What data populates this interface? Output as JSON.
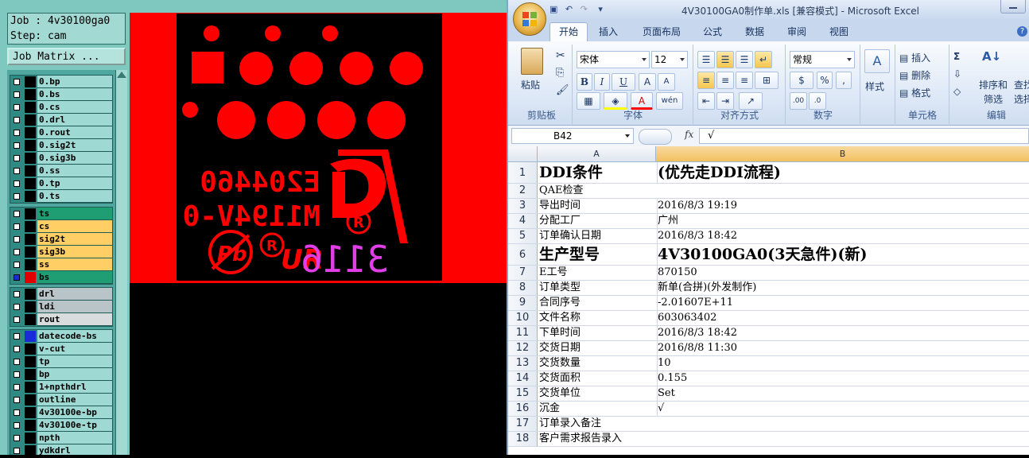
{
  "cam": {
    "job_label": "Job : 4v30100ga0",
    "step_label": "Step: cam",
    "matrix_button": "Job Matrix ...",
    "layer_groups": [
      {
        "layers": [
          {
            "name": "0.bp",
            "color": "#9fd9d3"
          },
          {
            "name": "0.bs",
            "color": "#9fd9d3"
          },
          {
            "name": "0.cs",
            "color": "#9fd9d3"
          },
          {
            "name": "0.drl",
            "color": "#9fd9d3"
          },
          {
            "name": "0.rout",
            "color": "#9fd9d3"
          },
          {
            "name": "0.sig2t",
            "color": "#9fd9d3"
          },
          {
            "name": "0.sig3b",
            "color": "#9fd9d3"
          },
          {
            "name": "0.ss",
            "color": "#9fd9d3"
          },
          {
            "name": "0.tp",
            "color": "#9fd9d3"
          },
          {
            "name": "0.ts",
            "color": "#9fd9d3"
          }
        ]
      },
      {
        "layers": [
          {
            "name": "ts",
            "color": "#1f9e74"
          },
          {
            "name": "cs",
            "color": "#ffcf66"
          },
          {
            "name": "sig2t",
            "color": "#ffcf66"
          },
          {
            "name": "sig3b",
            "color": "#ffcf66"
          },
          {
            "name": "ss",
            "color": "#ffcf66"
          },
          {
            "name": "bs",
            "color": "#1f9e74",
            "swatch": "#e00000",
            "selected": true
          }
        ]
      },
      {
        "layers": [
          {
            "name": "drl",
            "color": "#b8c4c8"
          },
          {
            "name": "ldi",
            "color": "#b8c4c8"
          },
          {
            "name": "rout",
            "color": "#d8dcdc"
          }
        ]
      },
      {
        "layers": [
          {
            "name": "datecode-bs",
            "color": "#9fd9d3",
            "swatch": "#1a2cd8"
          },
          {
            "name": "v-cut",
            "color": "#9fd9d3"
          },
          {
            "name": "tp",
            "color": "#9fd9d3"
          },
          {
            "name": "bp",
            "color": "#9fd9d3"
          },
          {
            "name": "1+npthdrl",
            "color": "#9fd9d3"
          },
          {
            "name": "outline",
            "color": "#9fd9d3"
          },
          {
            "name": "4v30100e-bp",
            "color": "#9fd9d3"
          },
          {
            "name": "4v30100e-tp",
            "color": "#9fd9d3"
          },
          {
            "name": "npth",
            "color": "#9fd9d3"
          },
          {
            "name": "ydkdrl",
            "color": "#9fd9d3"
          }
        ]
      }
    ],
    "board_text": {
      "line1": "E204460",
      "line2": "M1194V-0",
      "datecode": "3116",
      "ul_mark": "UR",
      "pb_mark": "Pb",
      "r_mark": "R"
    },
    "colors": {
      "copper": "#ff0000",
      "board": "#000000",
      "datecode": "#e23ee8"
    }
  },
  "excel": {
    "title": "4V30100GA0制作单.xls  [兼容模式] - Microsoft Excel",
    "tabs": [
      "开始",
      "插入",
      "页面布局",
      "公式",
      "数据",
      "审阅",
      "视图"
    ],
    "active_tab": "开始",
    "ribbon": {
      "clipboard": {
        "paste": "粘贴",
        "group": "剪贴板"
      },
      "font": {
        "name": "宋体",
        "size": "12",
        "group": "字体"
      },
      "alignment": {
        "group": "对齐方式"
      },
      "number": {
        "format": "常规",
        "percent": "%",
        "comma": ",",
        "group": "数字"
      },
      "styles": {
        "label": "样式"
      },
      "cells": {
        "insert": "插入",
        "delete": "删除",
        "format": "格式",
        "group": "单元格"
      },
      "editing": {
        "sort": "排序和",
        "sort2": "筛选",
        "find": "查找",
        "find2": "选择",
        "sum": "Σ",
        "group": "编辑"
      }
    },
    "formula": {
      "name_box": "B42",
      "fx": "fx",
      "value": "√"
    },
    "columns": [
      "A",
      "B"
    ],
    "rows": [
      {
        "n": "1",
        "a": "DDI条件",
        "b": "(优先走DDI流程)",
        "style": "big"
      },
      {
        "n": "2",
        "a": "QAE检查",
        "b": "",
        "style": "span"
      },
      {
        "n": "3",
        "a": "导出时间",
        "b": "2016/8/3 19:19"
      },
      {
        "n": "4",
        "a": "分配工厂",
        "b": "广州"
      },
      {
        "n": "5",
        "a": "订单确认日期",
        "b": "2016/8/3 18:42"
      },
      {
        "n": "6",
        "a": "生产型号",
        "b": "4V30100GA0(3天急件)(新)",
        "style": "big"
      },
      {
        "n": "7",
        "a": "E工号",
        "b": "870150"
      },
      {
        "n": "8",
        "a": "订单类型",
        "b": "新单(合拼)(外发制作)"
      },
      {
        "n": "9",
        "a": "合同序号",
        "b": "-2.01607E+11"
      },
      {
        "n": "10",
        "a": "文件名称",
        "b": "603063402"
      },
      {
        "n": "11",
        "a": "下单时间",
        "b": "2016/8/3 18:42"
      },
      {
        "n": "12",
        "a": "交货日期",
        "b": "2016/8/8 11:30"
      },
      {
        "n": "13",
        "a": "交货数量",
        "b": "10"
      },
      {
        "n": "14",
        "a": "交货面积",
        "b": "0.155"
      },
      {
        "n": "15",
        "a": "交货单位",
        "b": "Set"
      },
      {
        "n": "16",
        "a": "沉金",
        "b": "√"
      },
      {
        "n": "17",
        "a": "订单录入备注",
        "b": "",
        "style": "span"
      },
      {
        "n": "18",
        "a": "客户需求报告录入",
        "b": "",
        "style": "span"
      }
    ]
  }
}
